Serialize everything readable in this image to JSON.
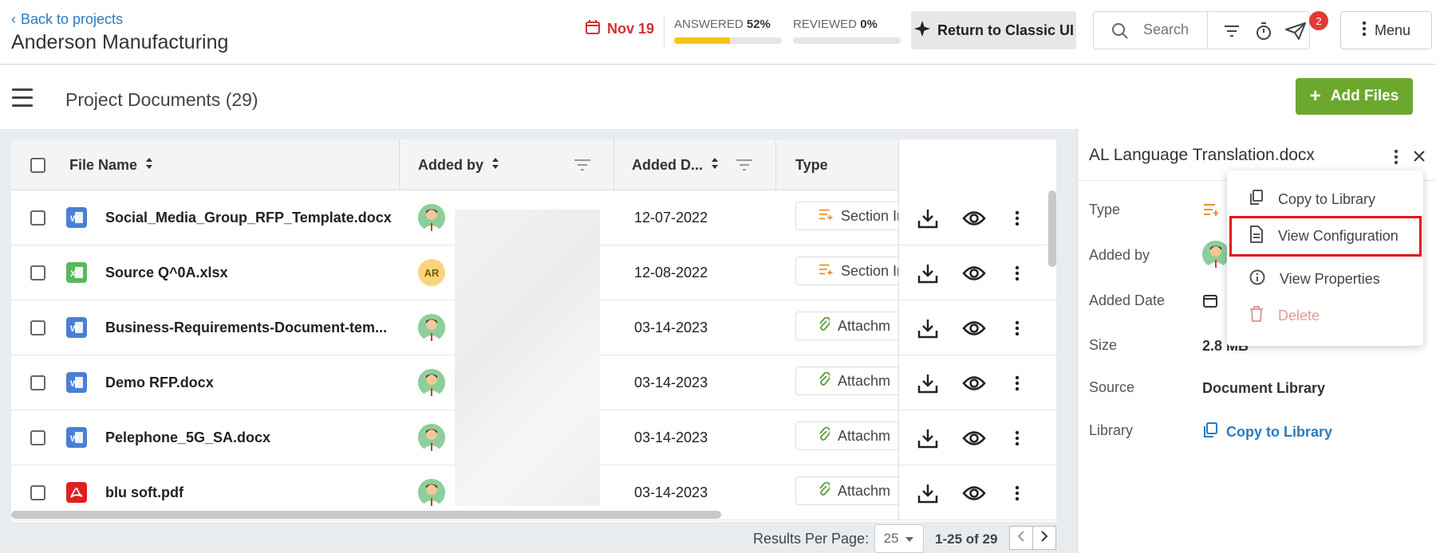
{
  "header": {
    "back_label": "Back to projects",
    "project_name": "Anderson Manufacturing",
    "due_date": "Nov 19",
    "answered_label": "ANSWERED",
    "answered_pct": "52%",
    "answered_fraction": 0.52,
    "reviewed_label": "REVIEWED",
    "reviewed_pct": "0%",
    "reviewed_fraction": 0,
    "classic_label": "Return to Classic UI",
    "search_placeholder": "Search",
    "notification_count": "2",
    "menu_label": "Menu"
  },
  "subheader": {
    "title": "Project Documents (29)",
    "add_files_label": "Add Files"
  },
  "table": {
    "columns": [
      "File Name",
      "Added by",
      "Added D...",
      "Type"
    ],
    "rows": [
      {
        "name": "Social_Media_Group_RFP_Template.docx",
        "filetype": "word",
        "avatar": "person",
        "date": "12-07-2022",
        "type": "Section Im",
        "type_icon": "section-icon"
      },
      {
        "name": "Source Q^0A.xlsx",
        "filetype": "excel",
        "avatar": "AR",
        "date": "12-08-2022",
        "type": "Section Im",
        "type_icon": "section-icon"
      },
      {
        "name": "Business-Requirements-Document-tem...",
        "filetype": "word",
        "avatar": "person",
        "date": "03-14-2023",
        "type": "Attachm",
        "type_icon": "paperclip-icon"
      },
      {
        "name": "Demo RFP.docx",
        "filetype": "word",
        "avatar": "person",
        "date": "03-14-2023",
        "type": "Attachm",
        "type_icon": "paperclip-icon"
      },
      {
        "name": "Pelephone_5G_SA.docx",
        "filetype": "word",
        "avatar": "person",
        "date": "03-14-2023",
        "type": "Attachm",
        "type_icon": "paperclip-icon"
      },
      {
        "name": "blu soft.pdf",
        "filetype": "pdf",
        "avatar": "person",
        "date": "03-14-2023",
        "type": "Attachm",
        "type_icon": "paperclip-icon"
      }
    ]
  },
  "footer": {
    "results_per_page_label": "Results Per Page:",
    "per_page_value": "25",
    "range": "1-25 of 29"
  },
  "panel": {
    "title": "AL Language Translation.docx",
    "labels": {
      "type": "Type",
      "added_by": "Added by",
      "added_date": "Added Date",
      "size": "Size",
      "source": "Source",
      "library": "Library"
    },
    "size_value": "2.8 MB",
    "source_value": "Document Library",
    "library_link": "Copy to Library"
  },
  "dropdown": {
    "items": [
      "Copy to Library",
      "View Configuration",
      "View Properties",
      "Delete"
    ]
  },
  "colors": {
    "accent_blue": "#2a7bc0",
    "add_green": "#6da82e",
    "due_red": "#d32f2f",
    "progress_yellow": "#f5c518",
    "highlight_red": "#e0121b"
  }
}
